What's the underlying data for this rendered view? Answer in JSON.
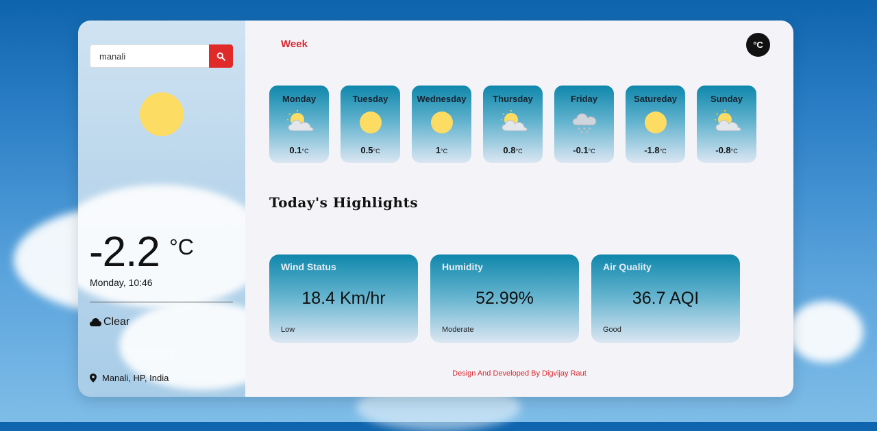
{
  "search": {
    "value": "manali"
  },
  "current": {
    "temp": "-2.2",
    "unit": "°C",
    "datetime": "Monday, 10:46",
    "condition": "Clear",
    "condition_icon": "cloud-icon",
    "location": "Manali, HP, India"
  },
  "header": {
    "week_tab": "Week",
    "unit_toggle": "°C"
  },
  "week": [
    {
      "day": "Monday",
      "temp": "0.1",
      "unit": "°C",
      "icon": "partly-cloudy-icon"
    },
    {
      "day": "Tuesday",
      "temp": "0.5",
      "unit": "°C",
      "icon": "sun-icon"
    },
    {
      "day": "Wednesday",
      "temp": "1",
      "unit": "°C",
      "icon": "sun-icon"
    },
    {
      "day": "Thursday",
      "temp": "0.8",
      "unit": "°C",
      "icon": "partly-cloudy-icon"
    },
    {
      "day": "Friday",
      "temp": "-0.1",
      "unit": "°C",
      "icon": "snow-icon"
    },
    {
      "day": "Satureday",
      "temp": "-1.8",
      "unit": "°C",
      "icon": "sun-icon"
    },
    {
      "day": "Sunday",
      "temp": "-0.8",
      "unit": "°C",
      "icon": "partly-cloudy-icon"
    }
  ],
  "highlights": {
    "title": "Today's  Highlights",
    "items": [
      {
        "label": "Wind Status",
        "value": "18.4 Km/hr",
        "sub": "Low"
      },
      {
        "label": "Humidity",
        "value": "52.99%",
        "sub": "Moderate"
      },
      {
        "label": "Air Quality",
        "value": "36.7 AQI",
        "sub": "Good"
      }
    ]
  },
  "footer": "Design And Developed By Digvijay Raut",
  "colors": {
    "accent": "#d9262e",
    "sun": "#fddc64",
    "card_top": "#0f87ab"
  }
}
